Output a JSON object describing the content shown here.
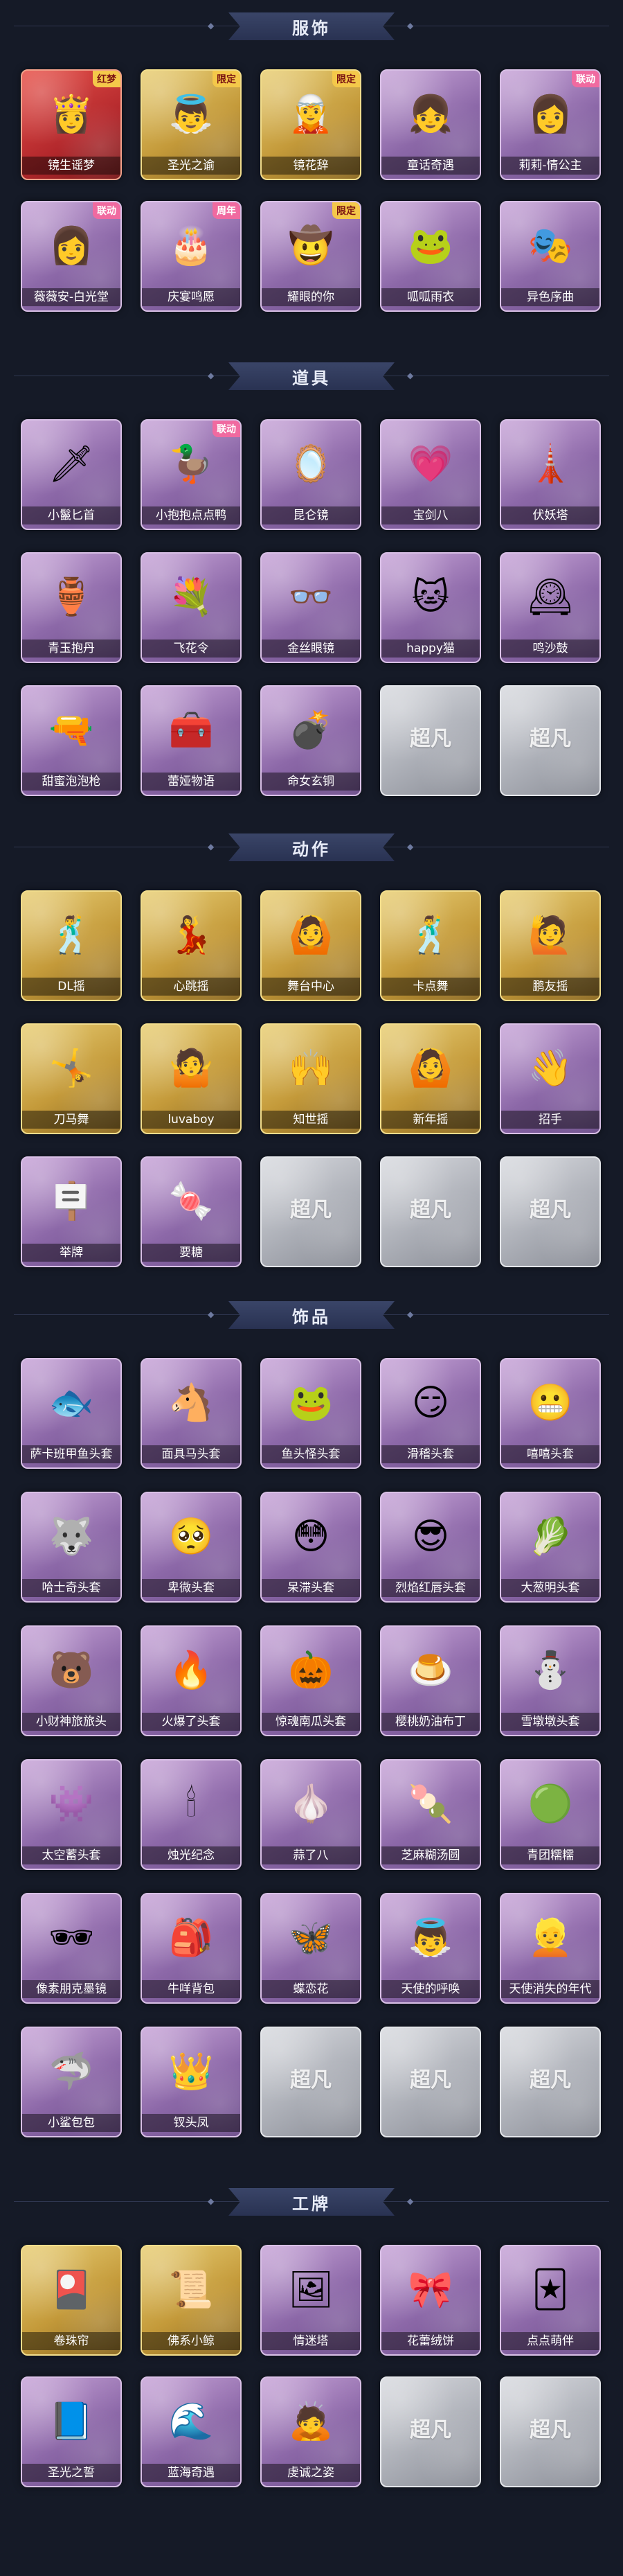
{
  "sections": [
    {
      "title": "服饰",
      "rows": [
        [
          {
            "label": "镜生谣梦",
            "style": "red",
            "icon": "crowned-portrait-icon",
            "glyph": "👸",
            "badge": "红梦"
          },
          {
            "label": "圣光之谕",
            "style": "gold",
            "icon": "angel-portrait-icon",
            "glyph": "👼",
            "badge": "限定"
          },
          {
            "label": "镜花辞",
            "style": "gold",
            "icon": "red-hood-portrait-icon",
            "glyph": "🧝",
            "badge": "限定"
          },
          {
            "label": "童话奇遇",
            "style": "purple",
            "icon": "girl-portrait-icon",
            "glyph": "👧",
            "badge": ""
          },
          {
            "label": "莉莉-情公主",
            "style": "purple",
            "icon": "pink-hair-portrait-icon",
            "glyph": "👩",
            "badge": "联动"
          }
        ],
        [
          {
            "label": "薇薇安-白光堂",
            "style": "purple",
            "icon": "long-hair-portrait-icon",
            "glyph": "👩",
            "badge": "联动"
          },
          {
            "label": "庆宴鸣愿",
            "style": "purple",
            "icon": "party-portrait-icon",
            "glyph": "🎂",
            "badge": "周年"
          },
          {
            "label": "耀眼的你",
            "style": "purple",
            "icon": "cowboy-hat-portrait-icon",
            "glyph": "🤠",
            "badge": "限定"
          },
          {
            "label": "呱呱雨衣",
            "style": "purple",
            "icon": "frog-hood-portrait-icon",
            "glyph": "🐸",
            "badge": ""
          },
          {
            "label": "异色序曲",
            "style": "purple",
            "icon": "gothic-portrait-icon",
            "glyph": "🎭",
            "badge": ""
          }
        ]
      ]
    },
    {
      "title": "道具",
      "rows": [
        [
          {
            "label": "小鬣匕首",
            "style": "purple",
            "icon": "dagger-icon",
            "glyph": "🗡",
            "badge": ""
          },
          {
            "label": "小抱抱点点鸭",
            "style": "purple",
            "icon": "duck-icon",
            "glyph": "🦆",
            "badge": "联动"
          },
          {
            "label": "昆仑镜",
            "style": "purple",
            "icon": "mirror-icon",
            "glyph": "🪞",
            "badge": ""
          },
          {
            "label": "宝剑八",
            "style": "purple",
            "icon": "heart-card-icon",
            "glyph": "💗",
            "badge": ""
          },
          {
            "label": "伏妖塔",
            "style": "purple",
            "icon": "pagoda-icon",
            "glyph": "🗼",
            "badge": ""
          }
        ],
        [
          {
            "label": "青玉抱丹",
            "style": "purple",
            "icon": "vase-icon",
            "glyph": "🏺",
            "badge": ""
          },
          {
            "label": "飞花令",
            "style": "purple",
            "icon": "flower-basket-icon",
            "glyph": "💐",
            "badge": ""
          },
          {
            "label": "金丝眼镜",
            "style": "purple",
            "icon": "glasses-icon",
            "glyph": "👓",
            "badge": ""
          },
          {
            "label": "happy猫",
            "style": "purple",
            "icon": "cat-icon",
            "glyph": "🐱",
            "badge": ""
          },
          {
            "label": "鸣沙鼓",
            "style": "purple",
            "icon": "drum-clock-icon",
            "glyph": "🕰",
            "badge": ""
          }
        ],
        [
          {
            "label": "甜蜜泡泡枪",
            "style": "purple",
            "icon": "bubble-gun-icon",
            "glyph": "🔫",
            "badge": ""
          },
          {
            "label": "蕾娅物语",
            "style": "purple",
            "icon": "medkit-icon",
            "glyph": "🧰",
            "badge": ""
          },
          {
            "label": "命女玄铜",
            "style": "purple",
            "icon": "grenade-icon",
            "glyph": "💣",
            "badge": ""
          },
          {
            "label": "",
            "style": "locked",
            "icon": "",
            "glyph": "",
            "badge": "",
            "lock": "超凡"
          },
          {
            "label": "",
            "style": "locked",
            "icon": "",
            "glyph": "",
            "badge": "",
            "lock": "超凡"
          }
        ]
      ]
    },
    {
      "title": "动作",
      "rows": [
        [
          {
            "label": "DL摇",
            "style": "gold",
            "icon": "pose-figure-icon",
            "glyph": "🕺",
            "badge": ""
          },
          {
            "label": "心跳摇",
            "style": "gold",
            "icon": "pose-figure-icon",
            "glyph": "💃",
            "badge": ""
          },
          {
            "label": "舞台中心",
            "style": "gold",
            "icon": "pose-figure-icon",
            "glyph": "🙆",
            "badge": ""
          },
          {
            "label": "卡点舞",
            "style": "gold",
            "icon": "pose-figure-icon",
            "glyph": "🕺",
            "badge": ""
          },
          {
            "label": "鹏友摇",
            "style": "gold",
            "icon": "pose-figure-icon",
            "glyph": "🙋",
            "badge": ""
          }
        ],
        [
          {
            "label": "刀马舞",
            "style": "gold",
            "icon": "pose-figure-icon",
            "glyph": "🤸",
            "badge": ""
          },
          {
            "label": "luvaboy",
            "style": "gold",
            "icon": "pose-figure-icon",
            "glyph": "🤷",
            "badge": ""
          },
          {
            "label": "知世摇",
            "style": "gold",
            "icon": "pose-figure-icon",
            "glyph": "🙌",
            "badge": ""
          },
          {
            "label": "新年摇",
            "style": "gold",
            "icon": "pose-figure-icon",
            "glyph": "🙆",
            "badge": ""
          },
          {
            "label": "招手",
            "style": "purple",
            "icon": "wave-figure-icon",
            "glyph": "👋",
            "badge": ""
          }
        ],
        [
          {
            "label": "举牌",
            "style": "purple",
            "icon": "sign-figure-icon",
            "glyph": "🪧",
            "badge": ""
          },
          {
            "label": "要糖",
            "style": "purple",
            "icon": "candy-figure-icon",
            "glyph": "🍬",
            "badge": ""
          },
          {
            "label": "",
            "style": "locked",
            "icon": "",
            "glyph": "",
            "badge": "",
            "lock": "超凡"
          },
          {
            "label": "",
            "style": "locked",
            "icon": "",
            "glyph": "",
            "badge": "",
            "lock": "超凡"
          },
          {
            "label": "",
            "style": "locked",
            "icon": "",
            "glyph": "",
            "badge": "",
            "lock": "超凡"
          }
        ]
      ]
    },
    {
      "title": "饰品",
      "rows": [
        [
          {
            "label": "萨卡班甲鱼头套",
            "style": "purple",
            "icon": "fish-head-icon",
            "glyph": "🐟",
            "badge": ""
          },
          {
            "label": "面具马头套",
            "style": "purple",
            "icon": "horse-head-icon",
            "glyph": "🐴",
            "badge": ""
          },
          {
            "label": "鱼头怪头套",
            "style": "purple",
            "icon": "frog-head-icon",
            "glyph": "🐸",
            "badge": ""
          },
          {
            "label": "滑稽头套",
            "style": "purple",
            "icon": "grin-face-icon",
            "glyph": "😏",
            "badge": ""
          },
          {
            "label": "嘻嘻头套",
            "style": "purple",
            "icon": "grimace-face-icon",
            "glyph": "😬",
            "badge": ""
          }
        ],
        [
          {
            "label": "哈士奇头套",
            "style": "purple",
            "icon": "husky-head-icon",
            "glyph": "🐺",
            "badge": ""
          },
          {
            "label": "卑微头套",
            "style": "purple",
            "icon": "sad-face-icon",
            "glyph": "🥺",
            "badge": ""
          },
          {
            "label": "呆滞头套",
            "style": "purple",
            "icon": "dazed-face-icon",
            "glyph": "😳",
            "badge": ""
          },
          {
            "label": "烈焰红唇头套",
            "style": "purple",
            "icon": "pikachu-head-icon",
            "glyph": "😎",
            "badge": ""
          },
          {
            "label": "大葱明头套",
            "style": "purple",
            "icon": "scallion-head-icon",
            "glyph": "🥬",
            "badge": ""
          }
        ],
        [
          {
            "label": "小财神旅旅头",
            "style": "purple",
            "icon": "bear-head-icon",
            "glyph": "🐻",
            "badge": ""
          },
          {
            "label": "火爆了头套",
            "style": "purple",
            "icon": "fire-head-icon",
            "glyph": "🔥",
            "badge": ""
          },
          {
            "label": "惊魂南瓜头套",
            "style": "purple",
            "icon": "pumpkin-head-icon",
            "glyph": "🎃",
            "badge": ""
          },
          {
            "label": "樱桃奶油布丁",
            "style": "purple",
            "icon": "pudding-head-icon",
            "glyph": "🍮",
            "badge": ""
          },
          {
            "label": "雪墩墩头套",
            "style": "purple",
            "icon": "snowman-head-icon",
            "glyph": "⛄",
            "badge": ""
          }
        ],
        [
          {
            "label": "太空蓄头套",
            "style": "purple",
            "icon": "blue-blob-icon",
            "glyph": "👾",
            "badge": ""
          },
          {
            "label": "烛光纪念",
            "style": "purple",
            "icon": "candle-icon",
            "glyph": "🕯",
            "badge": ""
          },
          {
            "label": "蒜了八",
            "style": "purple",
            "icon": "garlic-icon",
            "glyph": "🧄",
            "badge": ""
          },
          {
            "label": "芝麻糊汤圆",
            "style": "purple",
            "icon": "dumpling-icon",
            "glyph": "🍡",
            "badge": ""
          },
          {
            "label": "青团糯糯",
            "style": "purple",
            "icon": "green-bun-icon",
            "glyph": "🟢",
            "badge": ""
          }
        ],
        [
          {
            "label": "像素朋克墨镜",
            "style": "purple",
            "icon": "pixel-sunglasses-icon",
            "glyph": "🕶",
            "badge": ""
          },
          {
            "label": "牛咩背包",
            "style": "purple",
            "icon": "cake-backpack-icon",
            "glyph": "🎒",
            "badge": ""
          },
          {
            "label": "蝶恋花",
            "style": "purple",
            "icon": "butterfly-icon",
            "glyph": "🦋",
            "badge": ""
          },
          {
            "label": "天使的呼唤",
            "style": "purple",
            "icon": "angel-doll-icon",
            "glyph": "👼",
            "badge": ""
          },
          {
            "label": "天使消失的年代",
            "style": "purple",
            "icon": "angel-girl-icon",
            "glyph": "👱",
            "badge": ""
          }
        ],
        [
          {
            "label": "小鲨包包",
            "style": "purple",
            "icon": "shark-bag-icon",
            "glyph": "🦈",
            "badge": ""
          },
          {
            "label": "钗头凤",
            "style": "purple",
            "icon": "phoenix-hairpin-icon",
            "glyph": "👑",
            "badge": ""
          },
          {
            "label": "",
            "style": "locked",
            "icon": "",
            "glyph": "",
            "badge": "",
            "lock": "超凡"
          },
          {
            "label": "",
            "style": "locked",
            "icon": "",
            "glyph": "",
            "badge": "",
            "lock": "超凡"
          },
          {
            "label": "",
            "style": "locked",
            "icon": "",
            "glyph": "",
            "badge": "",
            "lock": "超凡"
          }
        ]
      ]
    },
    {
      "title": "工牌",
      "rows": [
        [
          {
            "label": "卷珠帘",
            "style": "gold",
            "icon": "badge-card-icon",
            "glyph": "🎴",
            "badge": ""
          },
          {
            "label": "佛系小鲸",
            "style": "gold",
            "icon": "badge-card-icon",
            "glyph": "📜",
            "badge": ""
          },
          {
            "label": "情迷塔",
            "style": "purple",
            "icon": "badge-card-icon",
            "glyph": "🖼",
            "badge": ""
          },
          {
            "label": "花蕾绒饼",
            "style": "purple",
            "icon": "badge-card-icon",
            "glyph": "🎀",
            "badge": ""
          },
          {
            "label": "点点萌伴",
            "style": "purple",
            "icon": "badge-card-icon",
            "glyph": "🃏",
            "badge": ""
          }
        ],
        [
          {
            "label": "圣光之誓",
            "style": "purple",
            "icon": "badge-card-icon",
            "glyph": "📘",
            "badge": ""
          },
          {
            "label": "蓝海奇遇",
            "style": "purple",
            "icon": "badge-card-icon",
            "glyph": "🌊",
            "badge": ""
          },
          {
            "label": "虔诚之姿",
            "style": "purple",
            "icon": "badge-card-icon",
            "glyph": "🙇",
            "badge": ""
          },
          {
            "label": "",
            "style": "locked",
            "icon": "",
            "glyph": "",
            "badge": "",
            "lock": "超凡"
          },
          {
            "label": "",
            "style": "locked",
            "icon": "",
            "glyph": "",
            "badge": "",
            "lock": "超凡"
          }
        ]
      ]
    }
  ]
}
